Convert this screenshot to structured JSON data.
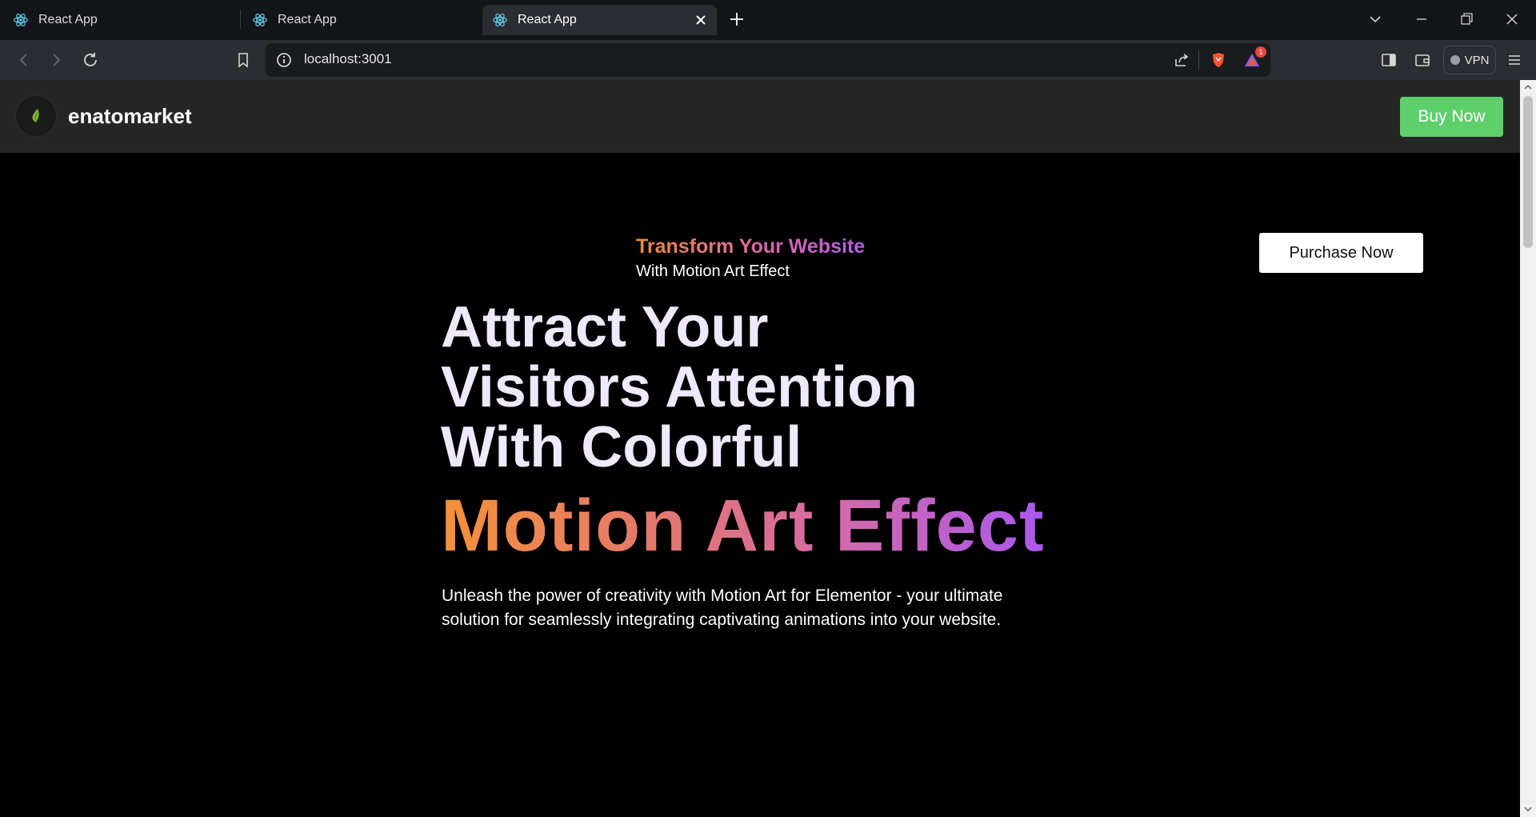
{
  "browser": {
    "tabs": [
      {
        "title": "React App",
        "active": false
      },
      {
        "title": "React App",
        "active": false
      },
      {
        "title": "React App",
        "active": true
      }
    ],
    "url": "localhost:3001",
    "vpn_label": "VPN",
    "notification_count": "1",
    "accent_colors": {
      "brave": "#fb542b",
      "rewards": "#8b5cf6"
    }
  },
  "header": {
    "brand": "enatomarket",
    "buy_label": "Buy Now",
    "buy_color": "#5fcf6b"
  },
  "hero": {
    "purchase_label": "Purchase Now",
    "eyebrow": "Transform Your Website",
    "eyebrow_sub": "With Motion Art Effect",
    "headline_lines": [
      "Attract Your",
      "Visitors Attention",
      "With Colorful"
    ],
    "gradient_title": "Motion Art Effect",
    "description": "Unleash the power of creativity with Motion Art for Elementor - your ultimate solution for seamlessly integrating captivating animations into your website.",
    "gradient_colors": [
      "#f4913a",
      "#d46aa8",
      "#a958ec"
    ]
  }
}
